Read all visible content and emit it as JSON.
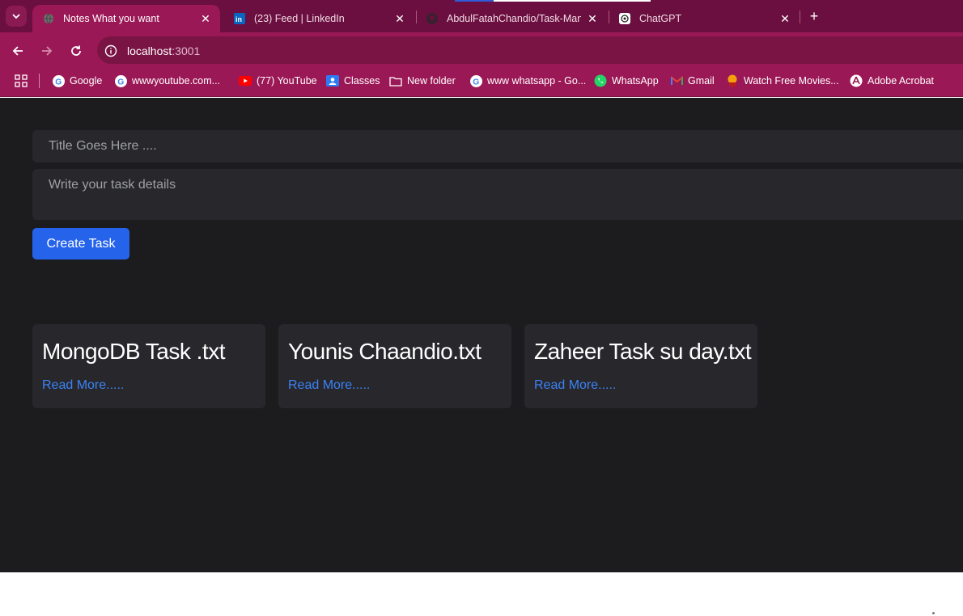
{
  "browser": {
    "tabs": [
      {
        "title": "Notes What you want",
        "active": true,
        "icon": "globe-icon"
      },
      {
        "title": "(23) Feed | LinkedIn",
        "active": false,
        "icon": "linkedin-icon"
      },
      {
        "title": "AbdulFatahChandio/Task-Mana",
        "active": false,
        "icon": "github-icon"
      },
      {
        "title": "ChatGPT",
        "active": false,
        "icon": "chatgpt-icon"
      }
    ],
    "new_tab_label": "+",
    "address": {
      "host": "localhost",
      "port": ":3001"
    },
    "bookmarks": [
      {
        "label": "Google",
        "icon": "google-icon"
      },
      {
        "label": "wwwyoutube.com...",
        "icon": "google-icon"
      },
      {
        "label": "(77) YouTube",
        "icon": "youtube-icon"
      },
      {
        "label": "Classes",
        "icon": "classroom-icon"
      },
      {
        "label": "New folder",
        "icon": "folder-icon"
      },
      {
        "label": "www whatsapp - Go...",
        "icon": "google-icon"
      },
      {
        "label": "WhatsApp",
        "icon": "whatsapp-icon"
      },
      {
        "label": "Gmail",
        "icon": "gmail-icon"
      },
      {
        "label": "Watch Free Movies...",
        "icon": "movies-icon"
      },
      {
        "label": "Adobe Acrobat",
        "icon": "acrobat-icon"
      }
    ]
  },
  "form": {
    "title_placeholder": "Title Goes Here ....",
    "details_placeholder": "Write your task details",
    "create_label": "Create Task"
  },
  "tasks": [
    {
      "title": "MongoDB Task .txt",
      "link": "Read More....."
    },
    {
      "title": "Younis Chaandio.txt",
      "link": "Read More....."
    },
    {
      "title": "Zaheer Task su day.txt",
      "link": "Read More....."
    }
  ],
  "colors": {
    "chrome_tabstrip": "#6a0f3f",
    "chrome_toolbar": "#9b1856",
    "page_bg": "#1c1c1f",
    "card_bg": "#28282c",
    "button_blue": "#2563eb",
    "link_blue": "#3b82f6"
  }
}
